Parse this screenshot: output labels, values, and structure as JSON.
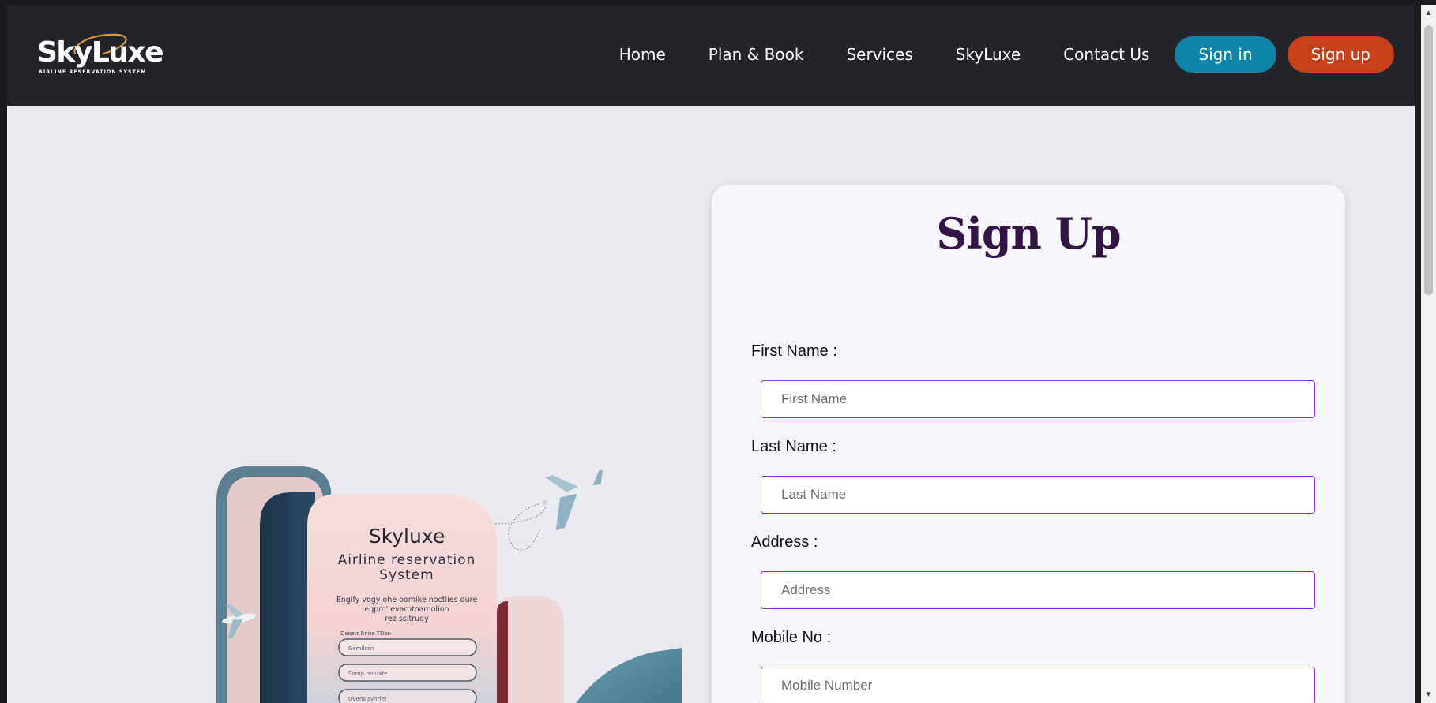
{
  "header": {
    "logo": {
      "word": "SkyLuxe",
      "tagline": "AIRLINE   RESERVATION   SYSTEM"
    },
    "nav": [
      {
        "label": "Home"
      },
      {
        "label": "Plan & Book"
      },
      {
        "label": "Services"
      },
      {
        "label": "SkyLuxe"
      },
      {
        "label": "Contact Us"
      }
    ],
    "signin_label": "Sign in",
    "signup_label": "Sign up"
  },
  "illustration": {
    "title": "Skyluxe",
    "subtitle_line1": "Airline reservation",
    "subtitle_line2": "System",
    "body_line1": "Engify vogy ohe oomike noctlies dure",
    "body_line2": "eqpm' evarotoamolion",
    "body_line3": "rez ssitruoy",
    "form_label": "Desetr Rnne TNer-",
    "input1": "Gemilcsn",
    "input2": "Somp renuate",
    "input3": "Ovens synrfel"
  },
  "form": {
    "title": "Sign Up",
    "fields": [
      {
        "label": "First Name :",
        "placeholder": "First Name"
      },
      {
        "label": "Last Name :",
        "placeholder": "Last Name"
      },
      {
        "label": "Address :",
        "placeholder": "Address"
      },
      {
        "label": "Mobile No :",
        "placeholder": "Mobile Number"
      }
    ]
  },
  "colors": {
    "navbar": "#23252b",
    "signin": "#0e84a8",
    "signup": "#c8401a",
    "title": "#331447",
    "input_border": "#9a2fd1"
  }
}
